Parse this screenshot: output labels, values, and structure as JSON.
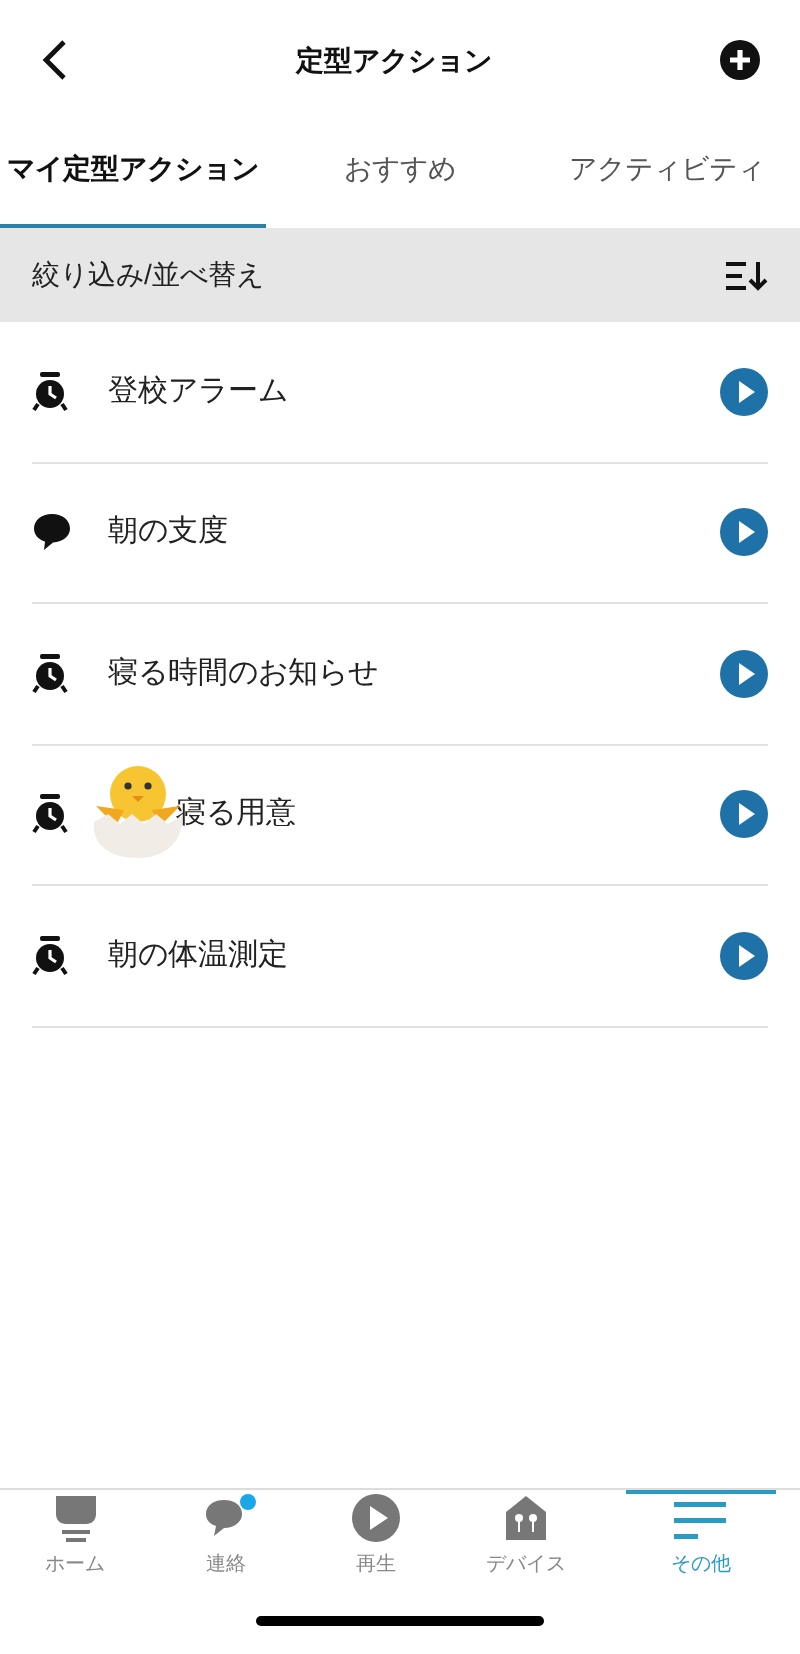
{
  "header": {
    "title": "定型アクション"
  },
  "tabs": [
    {
      "label": "マイ定型アクション",
      "selected": true
    },
    {
      "label": "おすすめ",
      "selected": false
    },
    {
      "label": "アクティビティ",
      "selected": false
    }
  ],
  "filter_bar": {
    "label": "絞り込み/並べ替え"
  },
  "routines": [
    {
      "kind": "alarm",
      "name": "登校アラーム"
    },
    {
      "kind": "speech",
      "name": "朝の支度"
    },
    {
      "kind": "alarm",
      "name": "寝る時間のお知らせ"
    },
    {
      "kind": "alarm",
      "name": "寝る用意",
      "sticker": true
    },
    {
      "kind": "alarm",
      "name": "朝の体温測定"
    }
  ],
  "nav": [
    {
      "kind": "home",
      "label": "ホーム",
      "selected": false,
      "badge": false
    },
    {
      "kind": "chat",
      "label": "連絡",
      "selected": false,
      "badge": true
    },
    {
      "kind": "play",
      "label": "再生",
      "selected": false,
      "badge": false
    },
    {
      "kind": "devices",
      "label": "デバイス",
      "selected": false,
      "badge": false
    },
    {
      "kind": "more",
      "label": "その他",
      "selected": true,
      "badge": false
    }
  ]
}
